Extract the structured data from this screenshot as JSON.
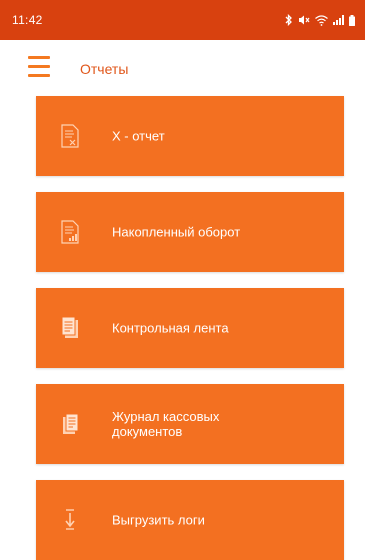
{
  "status_bar": {
    "time": "11:42",
    "icons": [
      "bluetooth-icon",
      "mute-icon",
      "wifi-icon",
      "signal-icon",
      "battery-icon"
    ]
  },
  "header": {
    "title": "Отчеты",
    "menu_icon": "hamburger-menu-icon"
  },
  "menu": {
    "items": [
      {
        "label": "Х - отчет",
        "icon": "x-report-icon"
      },
      {
        "label": "Накопленный оборот",
        "icon": "accumulated-turnover-icon"
      },
      {
        "label": "Контрольная лента",
        "icon": "control-tape-icon"
      },
      {
        "label": "Журнал кассовых\nдокументов",
        "icon": "cash-documents-journal-icon"
      },
      {
        "label": "Выгрузить логи",
        "icon": "upload-logs-icon"
      }
    ]
  },
  "colors": {
    "status_bar": "#d8410f",
    "accent": "#f37021",
    "title": "#e0561a"
  }
}
